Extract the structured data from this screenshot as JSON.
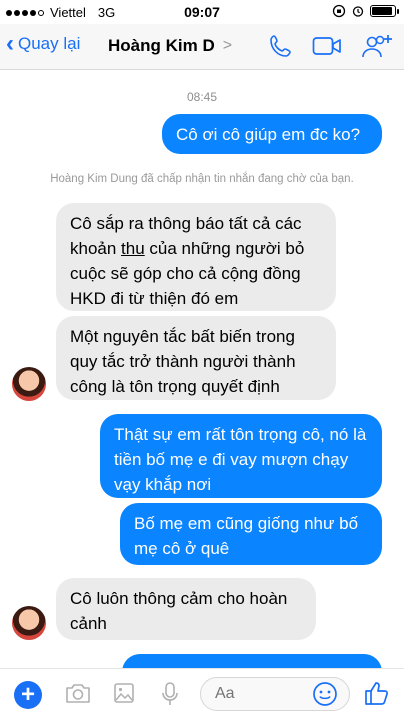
{
  "status_bar": {
    "carrier": "Viettel",
    "network": "3G",
    "time": "09:07"
  },
  "nav": {
    "back_label": "Quay lại",
    "contact_name": "Hoàng Kim D",
    "accent_color": "#1a6ff7"
  },
  "chat": {
    "timestamp": "08:45",
    "system_note": "Hoàng Kim Dung đã chấp nhận tin nhắn đang chờ của bạn.",
    "messages": [
      {
        "dir": "out",
        "text": "Cô ơi cô giúp em đc ko?"
      },
      {
        "dir": "in",
        "pre": "Cô sắp ra thông báo tất cả các khoản ",
        "underlined": "thu",
        "post": " của những người bỏ cuộc sẽ góp cho cả cộng đồng HKD đi từ thiện đó em"
      },
      {
        "dir": "in",
        "text": "Một nguyên tắc bất biến trong quy tắc trở thành người thành công là tôn trọng quyết định"
      },
      {
        "dir": "out",
        "text": "Thật sự em rất tôn trọng cô, nó là tiền bố mẹ e đi vay mượn chạy vạy khắp nơi"
      },
      {
        "dir": "out",
        "text": "Bố mẹ em cũng giống như bố mẹ cô ở quê"
      },
      {
        "dir": "in",
        "text": "Cô luôn thông cảm cho hoàn cảnh"
      }
    ],
    "outgoing_color": "#0a84ff",
    "incoming_color": "#ebebeb"
  },
  "composer": {
    "placeholder": "Aa"
  }
}
